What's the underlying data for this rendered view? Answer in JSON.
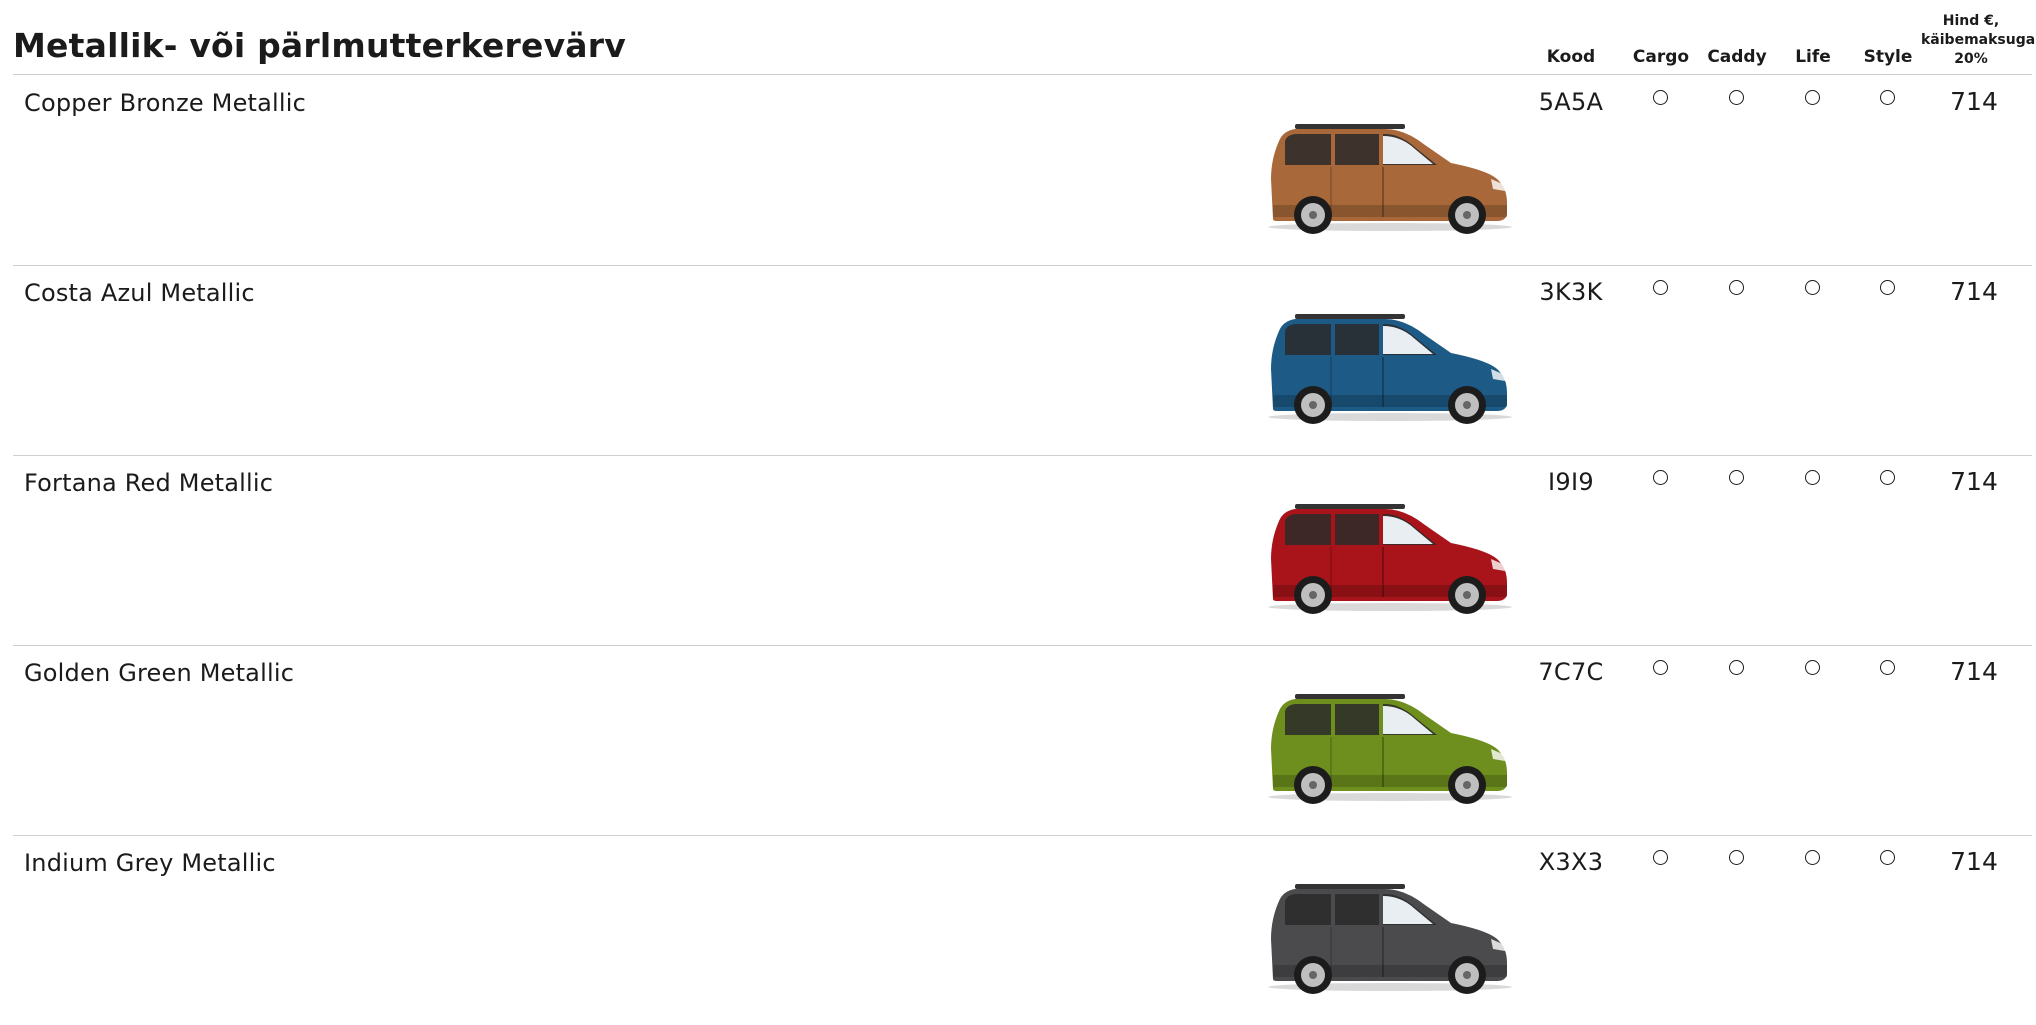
{
  "page": {
    "title": "Metallik- või pärlmutterkerevärv"
  },
  "table": {
    "headers": {
      "code": "Kood",
      "trims": [
        "Cargo",
        "Caddy",
        "Life",
        "Style"
      ],
      "price_lines": [
        "Hind €,",
        "käibemaksuga",
        "20%"
      ]
    },
    "rows": [
      {
        "name": "Copper Bronze Metallic",
        "code": "5A5A",
        "availability": [
          "○",
          "○",
          "○",
          "○"
        ],
        "price": "714",
        "color": "#a8683a"
      },
      {
        "name": "Costa Azul Metallic",
        "code": "3K3K",
        "availability": [
          "○",
          "○",
          "○",
          "○"
        ],
        "price": "714",
        "color": "#1d5a86"
      },
      {
        "name": "Fortana Red Metallic",
        "code": "I9I9",
        "availability": [
          "○",
          "○",
          "○",
          "○"
        ],
        "price": "714",
        "color": "#a8141a"
      },
      {
        "name": "Golden Green Metallic",
        "code": "7C7C",
        "availability": [
          "○",
          "○",
          "○",
          "○"
        ],
        "price": "714",
        "color": "#6e8f1e"
      },
      {
        "name": "Indium Grey Metallic",
        "code": "X3X3",
        "availability": [
          "○",
          "○",
          "○",
          "○"
        ],
        "price": "714",
        "color": "#4b4b4d"
      }
    ]
  },
  "icons": {
    "availability": "circle-outline-icon",
    "vehicle": "van-side-view-icon"
  }
}
